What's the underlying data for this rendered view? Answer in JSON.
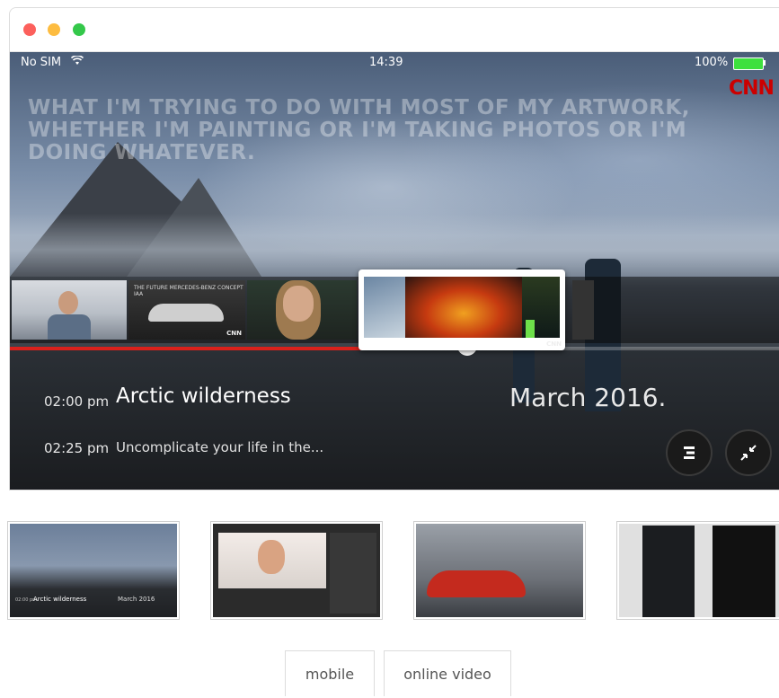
{
  "status_bar": {
    "carrier": "No SIM",
    "time": "14:39",
    "battery": "100%"
  },
  "brand": "CNN",
  "quote_overlay": "WHAT I'M TRYING TO DO WITH MOST OF MY ARTWORK, WHETHER I'M PAINTING OR I'M TAKING PHOTOS OR I'M DOING WHATEVER.",
  "filmstrip": {
    "thumb_mercedes_caption": "THE FUTURE MERCEDES-BENZ CONCEPT IAA",
    "thumb_brand": "CNN"
  },
  "playback_progress_percent": 58,
  "schedule": [
    {
      "time": "02:00 pm",
      "title": "Arctic wilderness"
    },
    {
      "time": "02:25 pm",
      "title": "Uncomplicate your life in the..."
    }
  ],
  "date_label": "March 2016.",
  "icons": {
    "menu": "menu-icon",
    "collapse": "collapse-icon",
    "wifi": "wifi-icon",
    "battery": "battery-icon"
  },
  "previews": {
    "p1_time": "02:00 pm",
    "p1_title": "Arctic wilderness",
    "p1_date": "March 2016"
  },
  "tabs": [
    {
      "label": "mobile"
    },
    {
      "label": "online video"
    }
  ],
  "colors": {
    "progress": "#d9211c",
    "brand_red": "#cc0000",
    "battery_green": "#3ee03e"
  }
}
